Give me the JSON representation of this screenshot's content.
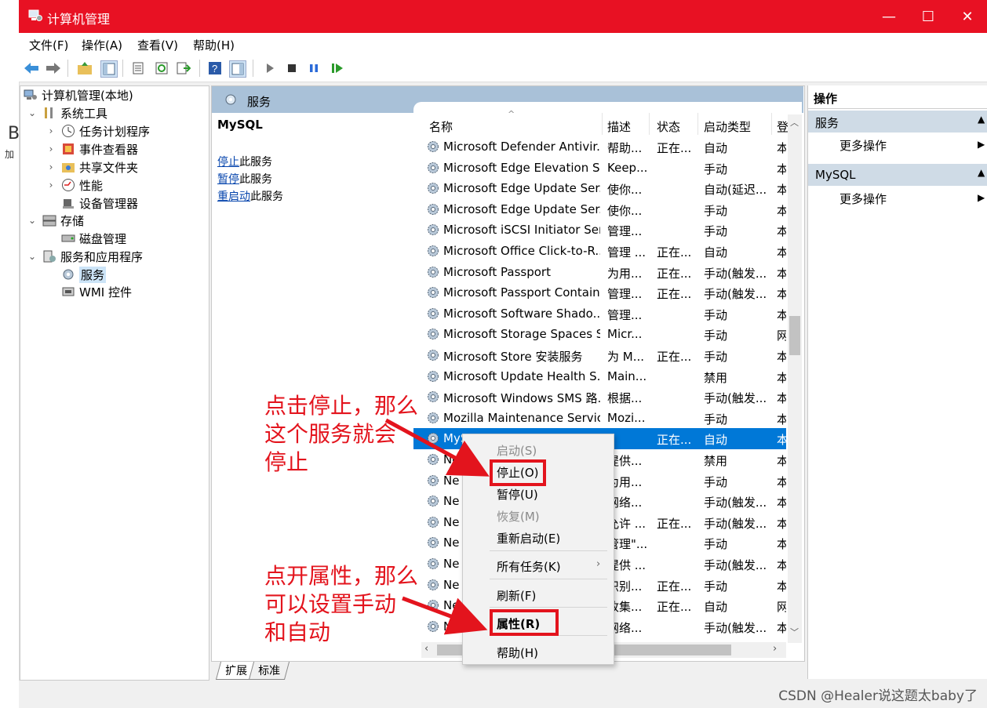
{
  "window": {
    "title": "计算机管理",
    "controls": [
      "—",
      "☐",
      "✕"
    ]
  },
  "menu": [
    "文件(F)",
    "操作(A)",
    "查看(V)",
    "帮助(H)"
  ],
  "tree": {
    "root": "计算机管理(本地)",
    "system_tools": "系统工具",
    "task_scheduler": "任务计划程序",
    "event_viewer": "事件查看器",
    "shared_folders": "共享文件夹",
    "performance": "性能",
    "device_manager": "设备管理器",
    "storage": "存储",
    "disk_management": "磁盘管理",
    "services_apps": "服务和应用程序",
    "services": "服务",
    "wmi": "WMI 控件"
  },
  "center": {
    "header": "服务",
    "selected_service": "MySQL",
    "actions": [
      {
        "link": "停止",
        "rest": "此服务"
      },
      {
        "link": "暂停",
        "rest": "此服务"
      },
      {
        "link": "重启动",
        "rest": "此服务"
      }
    ]
  },
  "grid": {
    "columns": [
      "名称",
      "描述",
      "状态",
      "启动类型",
      "登"
    ],
    "rows": [
      {
        "name": "Microsoft Defender Antivir...",
        "desc": "帮助...",
        "status": "正在...",
        "startup": "自动",
        "logon": "本"
      },
      {
        "name": "Microsoft Edge Elevation S...",
        "desc": "Keep...",
        "status": "",
        "startup": "手动",
        "logon": "本"
      },
      {
        "name": "Microsoft Edge Update Ser...",
        "desc": "使你...",
        "status": "",
        "startup": "自动(延迟...",
        "logon": "本"
      },
      {
        "name": "Microsoft Edge Update Ser...",
        "desc": "使你...",
        "status": "",
        "startup": "手动",
        "logon": "本"
      },
      {
        "name": "Microsoft iSCSI Initiator Ser...",
        "desc": "管理...",
        "status": "",
        "startup": "手动",
        "logon": "本"
      },
      {
        "name": "Microsoft Office Click-to-R...",
        "desc": "管理 ...",
        "status": "正在...",
        "startup": "自动",
        "logon": "本"
      },
      {
        "name": "Microsoft Passport",
        "desc": "为用...",
        "status": "正在...",
        "startup": "手动(触发...",
        "logon": "本"
      },
      {
        "name": "Microsoft Passport Container",
        "desc": "管理...",
        "status": "正在...",
        "startup": "手动(触发...",
        "logon": "本"
      },
      {
        "name": "Microsoft Software Shado...",
        "desc": "管理...",
        "status": "",
        "startup": "手动",
        "logon": "本"
      },
      {
        "name": "Microsoft Storage Spaces S...",
        "desc": "Micr...",
        "status": "",
        "startup": "手动",
        "logon": "网"
      },
      {
        "name": "Microsoft Store 安装服务",
        "desc": "为 M...",
        "status": "正在...",
        "startup": "手动",
        "logon": "本"
      },
      {
        "name": "Microsoft Update Health S...",
        "desc": "Main...",
        "status": "",
        "startup": "禁用",
        "logon": "本"
      },
      {
        "name": "Microsoft Windows SMS 路...",
        "desc": "根据...",
        "status": "",
        "startup": "手动(触发...",
        "logon": "本"
      },
      {
        "name": "Mozilla Maintenance Service",
        "desc": "Mozi...",
        "status": "",
        "startup": "手动",
        "logon": "本"
      },
      {
        "name": "MySQL",
        "desc": "",
        "status": "正在...",
        "startup": "自动",
        "logon": "本",
        "selected": true
      },
      {
        "name": "Ne",
        "desc": "提供...",
        "status": "",
        "startup": "禁用",
        "logon": "本"
      },
      {
        "name": "Ne",
        "desc": "为用...",
        "status": "",
        "startup": "手动",
        "logon": "本"
      },
      {
        "name": "Ne",
        "desc": "网络...",
        "status": "",
        "startup": "手动(触发...",
        "logon": "本"
      },
      {
        "name": "Ne",
        "desc": "允许 ...",
        "status": "正在...",
        "startup": "手动(触发...",
        "logon": "本"
      },
      {
        "name": "Ne",
        "desc": "管理\"...",
        "status": "",
        "startup": "手动",
        "logon": "本"
      },
      {
        "name": "Ne",
        "desc": "提供 ...",
        "status": "",
        "startup": "手动(触发...",
        "logon": "本"
      },
      {
        "name": "Ne",
        "desc": "识别...",
        "status": "正在...",
        "startup": "手动",
        "logon": "本"
      },
      {
        "name": "Ne",
        "desc": "收集...",
        "status": "正在...",
        "startup": "自动",
        "logon": "网"
      },
      {
        "name": "Ne",
        "desc": "网络...",
        "status": "",
        "startup": "手动(触发...",
        "logon": "本"
      }
    ]
  },
  "tabs": [
    "扩展",
    "标准"
  ],
  "actions_pane": {
    "title": "操作",
    "sections": [
      {
        "header": "服务",
        "item": "更多操作"
      },
      {
        "header": "MySQL",
        "item": "更多操作"
      }
    ]
  },
  "context_menu": {
    "start": "启动(S)",
    "stop": "停止(O)",
    "pause": "暂停(U)",
    "resume": "恢复(M)",
    "restart": "重新启动(E)",
    "all_tasks": "所有任务(K)",
    "refresh": "刷新(F)",
    "properties": "属性(R)",
    "help": "帮助(H)"
  },
  "annotations": {
    "note1": [
      "点击停止，那么",
      "这个服务就会",
      "停止"
    ],
    "note2": [
      "点开属性，那么",
      "可以设置手动",
      "和自动"
    ]
  },
  "watermark": "CSDN @Healer说这题太baby了",
  "background_window": {
    "letter": "B",
    "text": "加"
  },
  "colors": {
    "titlebar": "#e81123",
    "selection": "#0078d7",
    "annotation": "#e3141d",
    "header": "#a9c1d8"
  }
}
